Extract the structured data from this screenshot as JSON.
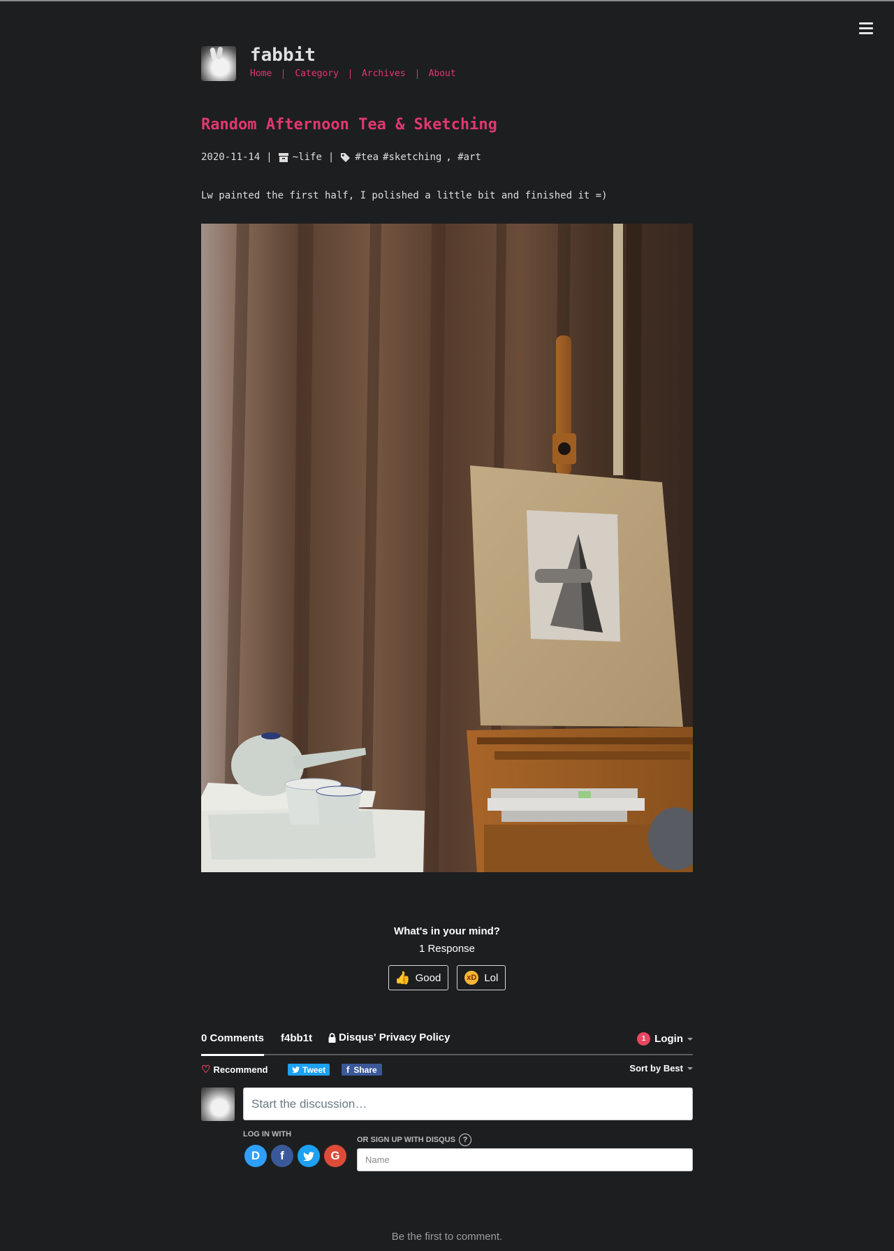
{
  "site": {
    "title": "fabbit",
    "nav": [
      {
        "label": "Home"
      },
      {
        "label": "Category"
      },
      {
        "label": "Archives"
      },
      {
        "label": "About"
      }
    ]
  },
  "post": {
    "title": "Random Afternoon Tea & Sketching",
    "date": "2020-11-14",
    "category": "~life",
    "tags": [
      "#tea",
      "#sketching",
      ", #art"
    ],
    "excerpt": "Lw painted the first half, I polished a little bit and finished it =)"
  },
  "reactions": {
    "title": "What's in your mind?",
    "count": "1 Response",
    "items": [
      {
        "label": "Good",
        "icon": "thumbs-up-icon"
      },
      {
        "label": "Lol",
        "icon": "laughing-face-icon"
      }
    ]
  },
  "disqus": {
    "comments_tab": "0 Comments",
    "site_tab": "f4bb1t",
    "privacy": "Disqus' Privacy Policy",
    "notification_count": "1",
    "login": "Login",
    "recommend": "Recommend",
    "tweet": "Tweet",
    "share": "Share",
    "sort": "Sort by Best",
    "composer_placeholder": "Start the discussion…",
    "login_with": "LOG IN WITH",
    "signup_with": "OR SIGN UP WITH DISQUS",
    "name_placeholder": "Name",
    "social": [
      {
        "glyph": "D",
        "icon": "disqus-icon"
      },
      {
        "glyph": "f",
        "icon": "facebook-icon"
      },
      {
        "glyph": "t",
        "icon": "twitter-icon"
      },
      {
        "glyph": "G",
        "icon": "google-icon"
      }
    ],
    "empty_state": "Be the first to comment."
  },
  "colors": {
    "background": "#1d1e20",
    "accent": "#e0386f",
    "text": "#dedede",
    "tweet": "#1da1f2",
    "facebook": "#3b5999"
  }
}
